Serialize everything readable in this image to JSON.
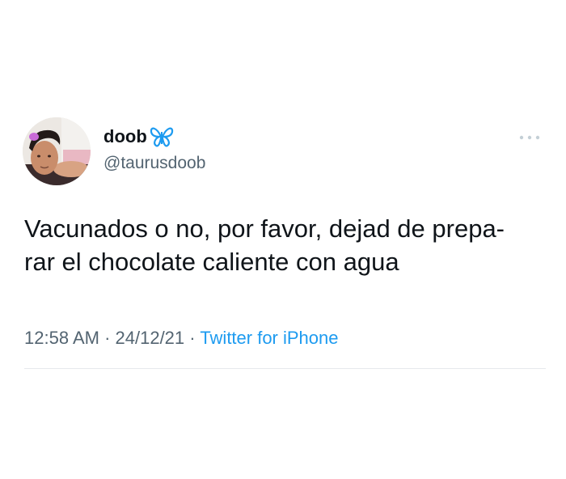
{
  "tweet": {
    "author": {
      "display_name": "doob",
      "name_emoji_icon": "blue-butterfly-icon",
      "handle": "@taurusdoob"
    },
    "more_icon": "ellipsis-icon",
    "text_lines": [
      "Vacunados o no, por favor, dejad de prepa-",
      "rar el chocolate caliente con agua"
    ],
    "meta": {
      "time": "12:58 AM",
      "separator": " · ",
      "date": "24/12/21",
      "source": "Twitter for iPhone"
    },
    "colors": {
      "text": "#0f1419",
      "secondary": "#536471",
      "link": "#1d9bf0",
      "butterfly": "#1d9bf0"
    }
  }
}
